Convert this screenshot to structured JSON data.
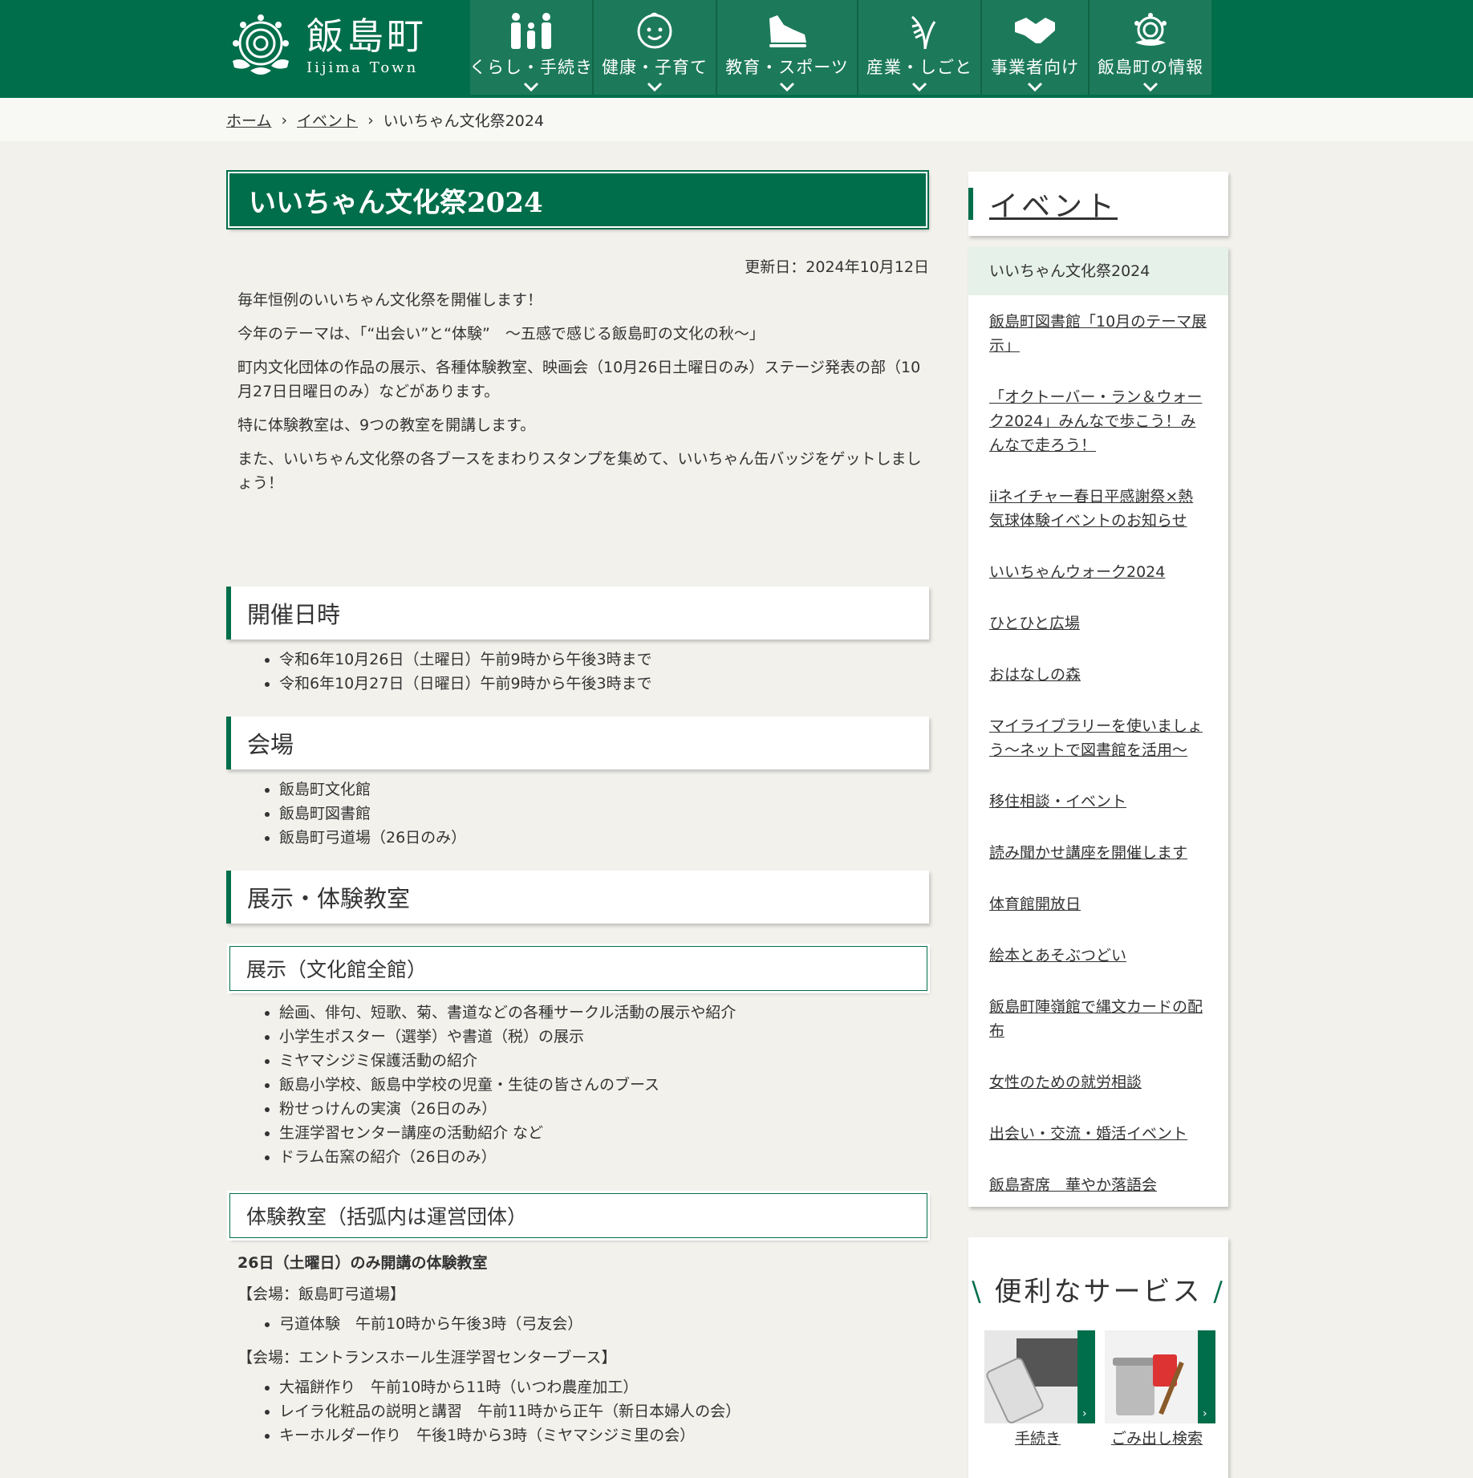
{
  "header": {
    "logo_jp": "飯島町",
    "logo_en": "Iijima Town",
    "nav": [
      {
        "label": "くらし・手続き",
        "icon": "family-icon"
      },
      {
        "label": "健康・子育て",
        "icon": "baby-face-icon"
      },
      {
        "label": "教育・スポーツ",
        "icon": "sneaker-icon"
      },
      {
        "label": "産業・しごと",
        "icon": "rice-plant-icon"
      },
      {
        "label": "事業者向け",
        "icon": "handshake-icon"
      },
      {
        "label": "飯島町の情報",
        "icon": "town-emblem-icon"
      }
    ]
  },
  "breadcrumb": {
    "home": "ホーム",
    "events": "イベント",
    "current": "いいちゃん文化祭2024"
  },
  "main": {
    "title": "いいちゃん文化祭2024",
    "updated": "更新日：2024年10月12日",
    "intro": [
      "毎年恒例のいいちゃん文化祭を開催します！",
      "今年のテーマは、「“出会い”と“体験”　～五感で感じる飯島町の文化の秋～」",
      "町内文化団体の作品の展示、各種体験教室、映画会（10月26日土曜日のみ）ステージ発表の部（10月27日日曜日のみ）などがあります。",
      "特に体験教室は、9つの教室を開講します。",
      "また、いいちゃん文化祭の各ブースをまわりスタンプを集めて、いいちゃん缶バッジをゲットしましょう！"
    ],
    "schedule_heading": "開催日時",
    "schedule": [
      "令和6年10月26日（土曜日）午前9時から午後3時まで",
      "令和6年10月27日（日曜日）午前9時から午後3時まで"
    ],
    "venue_heading": "会場",
    "venues": [
      "飯島町文化館",
      "飯島町図書館",
      "飯島町弓道場（26日のみ）"
    ],
    "exhibit_heading": "展示・体験教室",
    "exhibit_sub": "展示（文化館全館）",
    "exhibits": [
      "絵画、俳句、短歌、菊、書道などの各種サークル活動の展示や紹介",
      "小学生ポスター（選挙）や書道（税）の展示",
      "ミヤマシジミ保護活動の紹介",
      "飯島小学校、飯島中学校の児童・生徒の皆さんのブース",
      "粉せっけんの実演（26日のみ）",
      "生涯学習センター講座の活動紹介 など",
      "ドラム缶窯の紹介（26日のみ）"
    ],
    "class_sub": "体験教室（括弧内は運営団体）",
    "day26_heading": "26日（土曜日）のみ開講の体験教室",
    "venue_kyudo": "【会場：飯島町弓道場】",
    "kyudo_items": [
      "弓道体験　午前10時から午後3時（弓友会）"
    ],
    "venue_entrance": "【会場：エントランスホール生涯学習センターブース】",
    "entrance_items": [
      "大福餅作り　午前10時から11時（いつわ農産加工）",
      "レイラ化粧品の説明と講習　午前11時から正午（新日本婦人の会）",
      "キーホルダー作り　午後1時から3時（ミヤマシジミ里の会）"
    ]
  },
  "sidebar": {
    "heading": "イベント",
    "current": "いいちゃん文化祭2024",
    "links": [
      "飯島町図書館「10月のテーマ展示」",
      "「オクトーバー・ラン＆ウォーク2024」みんなで歩こう！みんなで走ろう！",
      "iiネイチャー春日平感謝祭×熱気球体験イベントのお知らせ",
      "いいちゃんウォーク2024",
      "ひとひと広場",
      "おはなしの森",
      "マイライブラリーを使いましょう～ネットで図書館を活用～",
      "移住相談・イベント",
      "読み聞かせ講座を開催します",
      "体育館開放日",
      "絵本とあそぶつどい",
      "飯島町陣嶺館で縄文カードの配布",
      "女性のための就労相談",
      "出会い・交流・婚活イベント",
      "飯島寄席　華やか落語会"
    ],
    "services_title": "便利なサービス",
    "services": [
      "手続き",
      "ごみ出し検索"
    ]
  },
  "colors": {
    "brand_green": "#006e4a",
    "background": "#f2f1ec"
  }
}
